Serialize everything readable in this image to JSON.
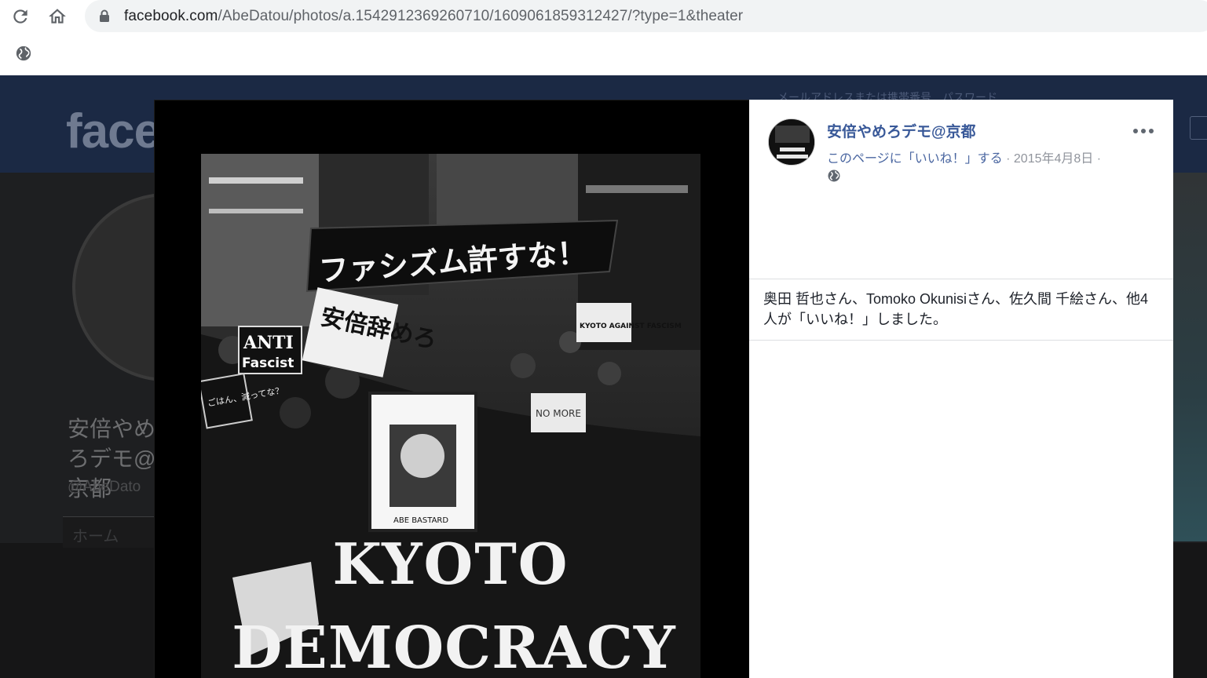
{
  "browser": {
    "url_domain": "facebook.com",
    "url_path": "/AbeDatou/photos/a.154291236926071​0/1609061859312427/?type=1&theater",
    "icons": [
      "reload-icon",
      "home-icon",
      "lock-icon",
      "globe-icon"
    ]
  },
  "background_page": {
    "logo": "face",
    "page_name": "安倍やめろデモ@京都",
    "handle": "@AbeDato",
    "home_tab": "ホーム",
    "login_hint": "メールアドレスまたは携帯番号　パスワード"
  },
  "photo": {
    "banner_text": "ファシズム許すな！",
    "sign_abe": "安倍辞めろ",
    "sign_anti": "ANTI",
    "sign_fascist": "Fascist",
    "sign_kyoto": "KYOTO AGAINST FASCISM",
    "sign_abe_bastard": "ABE BASTARD",
    "sign_no_more": "NO MORE",
    "sign_gohan": "ごはん、減ってな？",
    "caption_line1": "KYOTO",
    "caption_line2": "DEMOCRACY"
  },
  "panel": {
    "poster_name": "安倍やめろデモ@京都",
    "like_page": "このページに「いいね！」する",
    "separator": " · ",
    "date": "2015年4月8日",
    "separator_end": " ·",
    "likes_text": "奥田 哲也さん、Tomoko Okunisiさん、佐久間 千絵さん、他4人が「いいね！」しました。"
  },
  "colors": {
    "link_blue": "#385898",
    "fb_topbar": "#1b2944",
    "meta_gray": "#90949c"
  }
}
